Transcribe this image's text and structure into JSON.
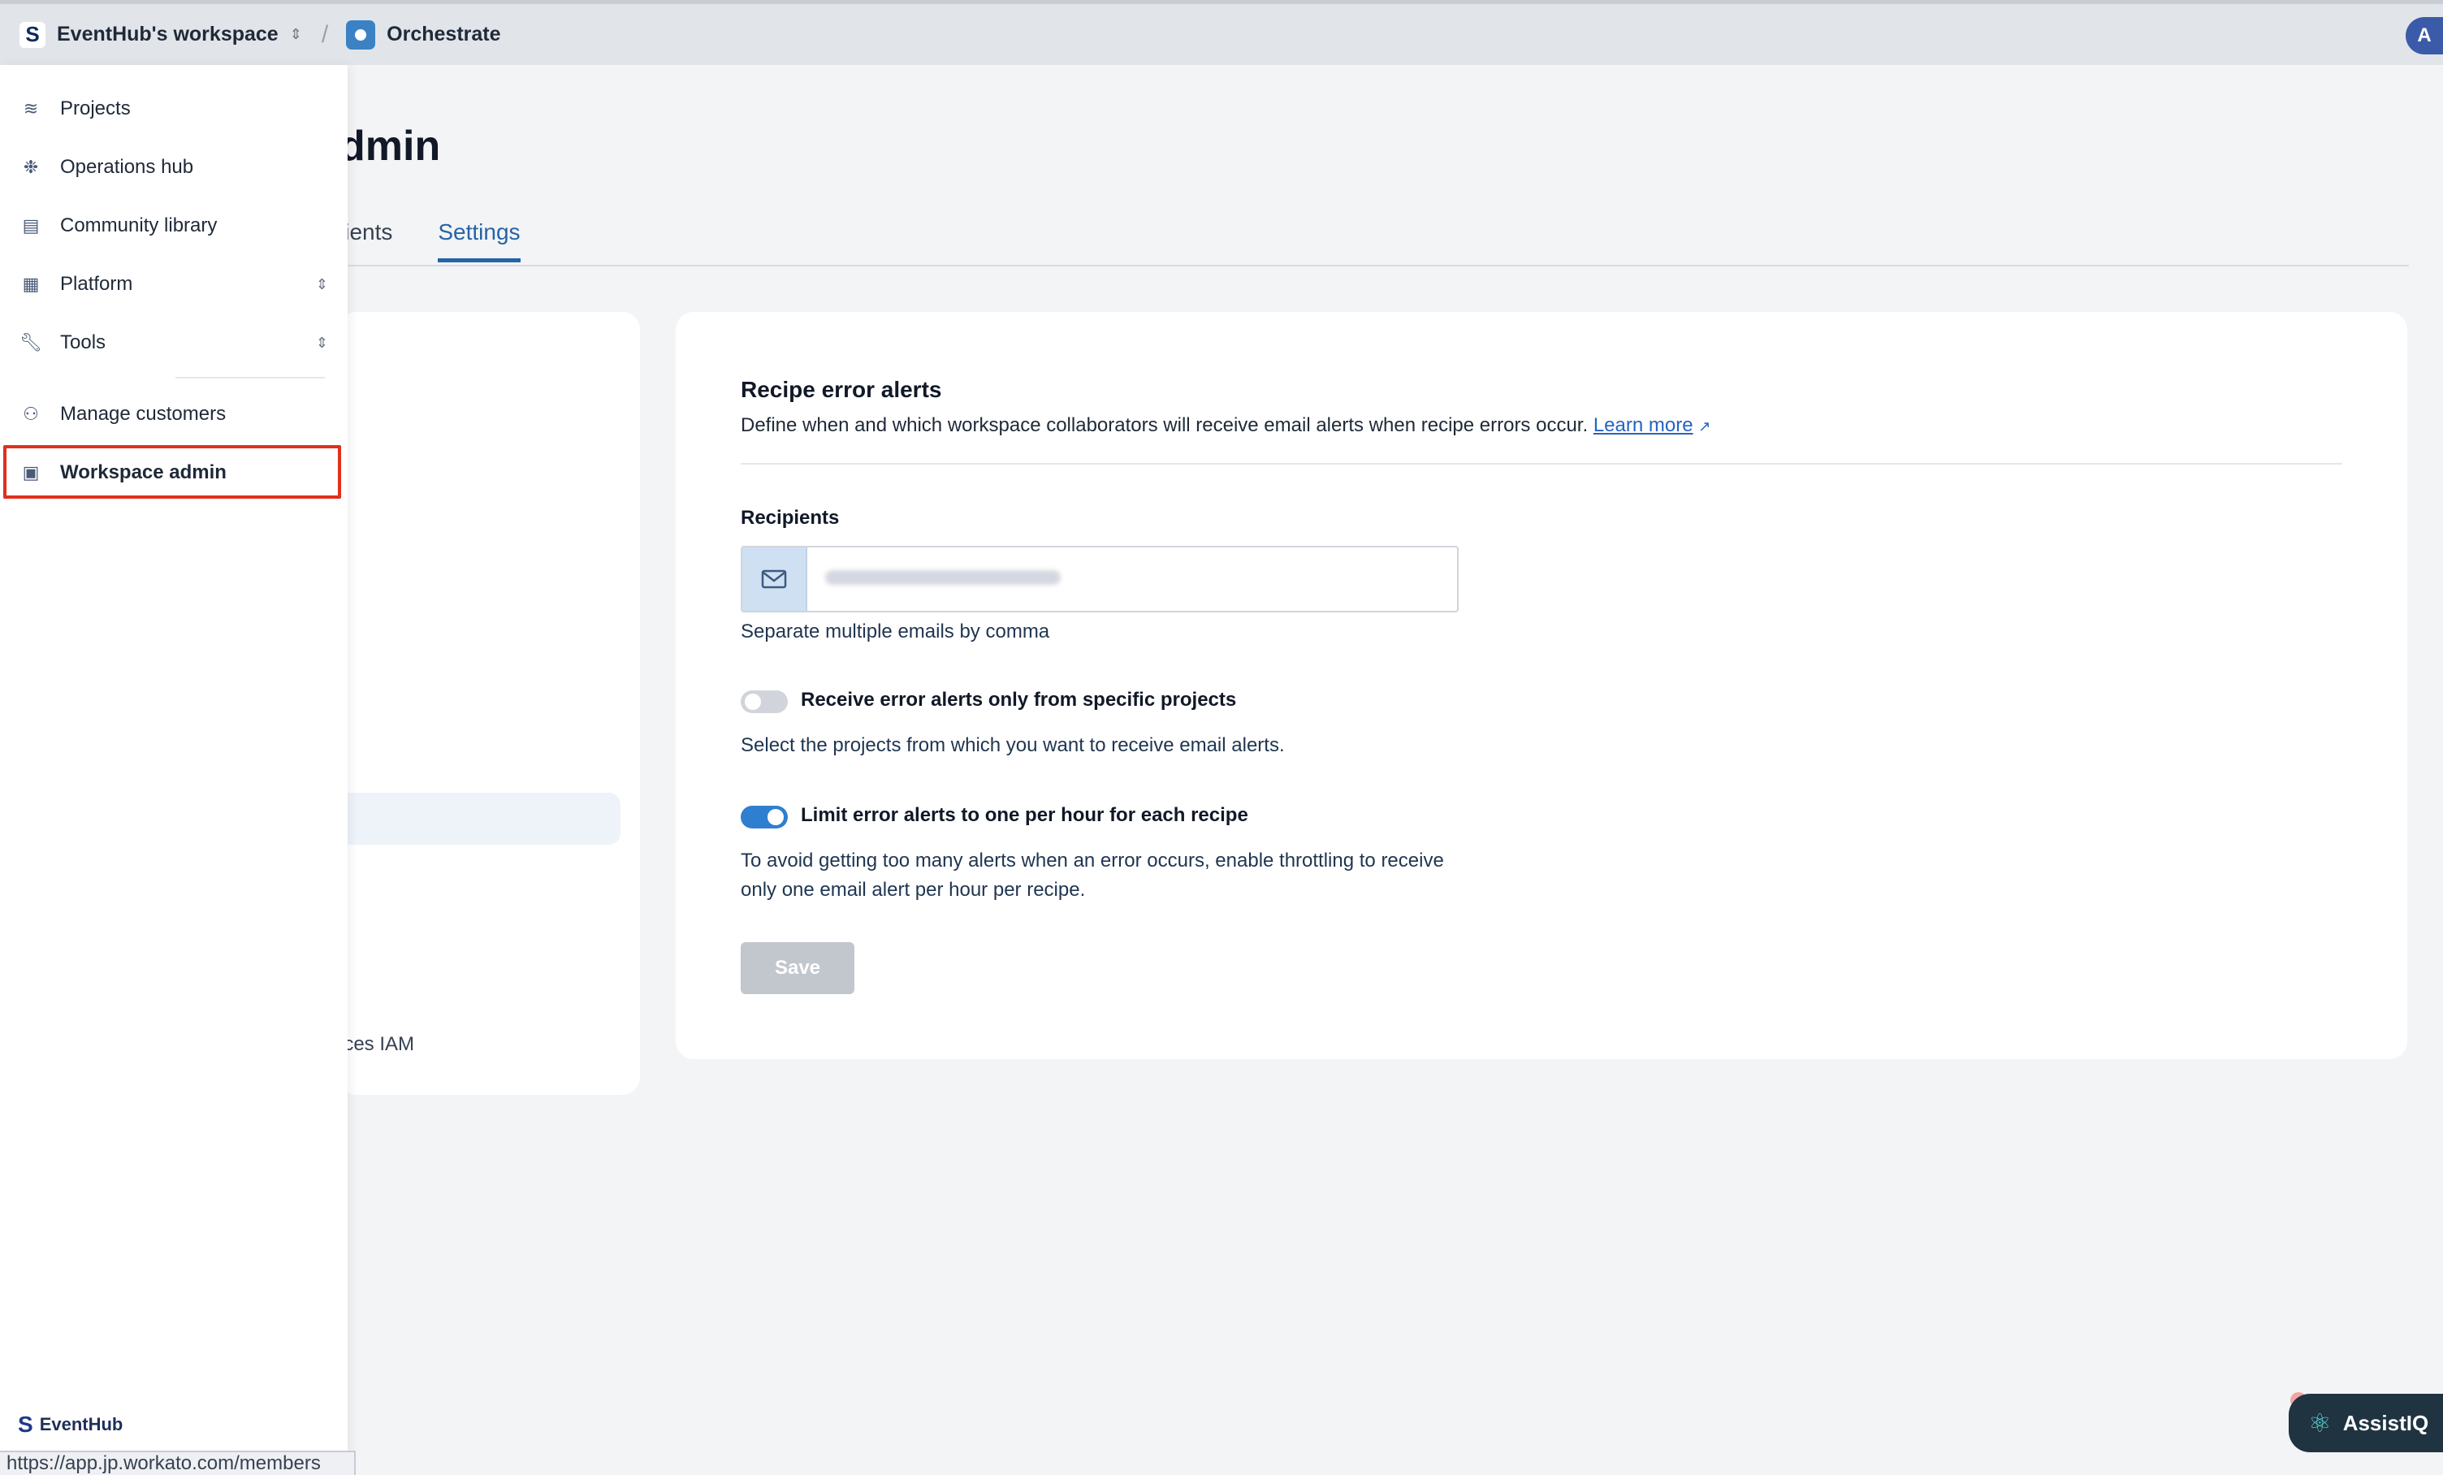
{
  "topbar": {
    "workspace_name": "EventHub's workspace",
    "app_name": "Orchestrate",
    "avatar_initial": "A"
  },
  "page": {
    "title_partial": "dmin",
    "tabs": [
      {
        "label": "lients",
        "active": false
      },
      {
        "label": "Settings",
        "active": true
      }
    ],
    "left_panel_partial_item": "ices IAM"
  },
  "alerts": {
    "heading": "Recipe error alerts",
    "description": "Define when and which workspace collaborators will receive email alerts when recipe errors occur.",
    "learn_more": "Learn more",
    "recipients_label": "Recipients",
    "recipients_value": "",
    "recipients_help": "Separate multiple emails by comma",
    "toggle_specific_label": "Receive error alerts only from specific projects",
    "toggle_specific_on": false,
    "toggle_specific_desc": "Select the projects from which you want to receive email alerts.",
    "toggle_limit_label": "Limit error alerts to one per hour for each recipe",
    "toggle_limit_on": true,
    "toggle_limit_desc": "To avoid getting too many alerts when an error occurs, enable throttling to receive only one email alert per hour per recipe.",
    "save_label": "Save"
  },
  "sidebar": {
    "items": [
      {
        "label": "Projects",
        "icon": "layers-icon"
      },
      {
        "label": "Operations hub",
        "icon": "snowflake-icon"
      },
      {
        "label": "Community library",
        "icon": "book-icon"
      },
      {
        "label": "Platform",
        "icon": "grid-icon"
      },
      {
        "label": "Tools",
        "icon": "wrench-icon"
      },
      {
        "label": "Manage customers",
        "icon": "users-gear-icon"
      },
      {
        "label": "Workspace admin",
        "icon": "building-gear-icon"
      }
    ],
    "brand": "EventHub"
  },
  "statusbar": {
    "url": "https://app.jp.workato.com/members"
  },
  "assistant": {
    "label": "AssistIQ"
  },
  "colors": {
    "accent": "#2563a8",
    "toggle_on": "#2f7fd0",
    "highlight": "#e0301e",
    "save_disabled": "#c2c7ce"
  }
}
